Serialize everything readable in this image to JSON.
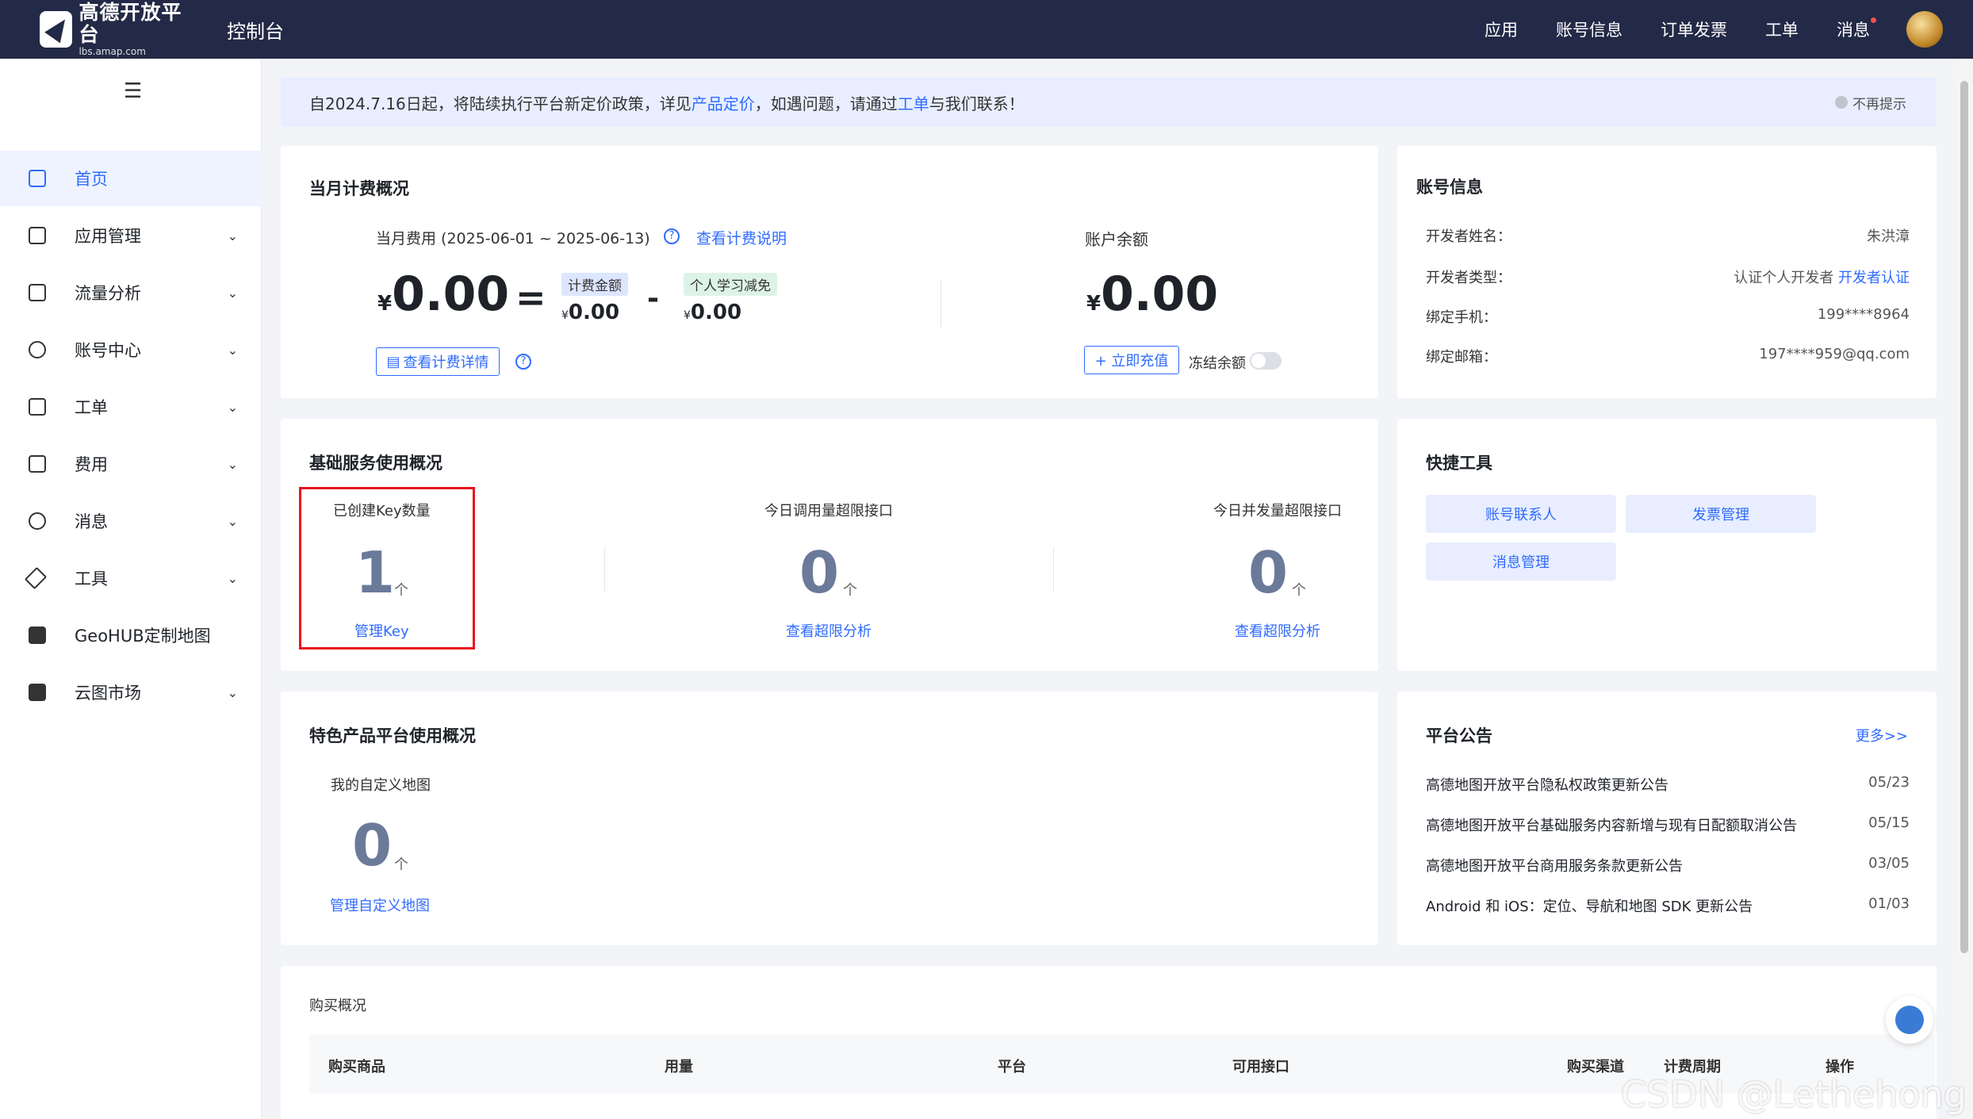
{
  "header": {
    "logo_title": "高德开放平台",
    "logo_sub": "lbs.amap.com",
    "console": "控制台",
    "nav": [
      "应用",
      "账号信息",
      "订单发票",
      "工单",
      "消息"
    ]
  },
  "sidebar": {
    "items": [
      {
        "label": "首页",
        "icon": "home-icon",
        "chevron": false
      },
      {
        "label": "应用管理",
        "icon": "grid-icon",
        "chevron": true
      },
      {
        "label": "流量分析",
        "icon": "chart-icon",
        "chevron": true
      },
      {
        "label": "账号中心",
        "icon": "user-icon",
        "chevron": true
      },
      {
        "label": "工单",
        "icon": "ticket-icon",
        "chevron": true
      },
      {
        "label": "费用",
        "icon": "yen-icon",
        "chevron": true
      },
      {
        "label": "消息",
        "icon": "message-icon",
        "chevron": true
      },
      {
        "label": "工具",
        "icon": "wrench-icon",
        "chevron": true
      },
      {
        "label": "GeoHUB定制地图",
        "icon": "layers-icon",
        "chevron": false
      },
      {
        "label": "云图市场",
        "icon": "store-icon",
        "chevron": true
      }
    ]
  },
  "notice": {
    "part1": "自2024.7.16日起，将陆续执行平台新定价政策，详见",
    "link1": "产品定价",
    "part2": "，如遇问题，请通过",
    "link2": "工单",
    "part3": "与我们联系！",
    "dismiss": "不再提示"
  },
  "billing": {
    "title": "当月计费概况",
    "period_label": "当月费用 (2025-06-01 ~ 2025-06-13)",
    "explain_link": "查看计费说明",
    "currency": "¥",
    "total": "0.00",
    "equals": "=",
    "minus": "-",
    "charge_tag": "计费金额",
    "charge_value": "0.00",
    "discount_tag": "个人学习减免",
    "discount_value": "0.00",
    "detail_button": "查看计费详情",
    "balance_label": "账户余额",
    "balance": "0.00",
    "recharge_button": "+ 立即充值",
    "freeze_label": "冻结余额"
  },
  "account": {
    "title": "账号信息",
    "rows": [
      {
        "label": "开发者姓名：",
        "value": "朱洪漳"
      },
      {
        "label": "开发者类型：",
        "value": "认证个人开发者",
        "link": "开发者认证"
      },
      {
        "label": "绑定手机：",
        "value": "199****8964"
      },
      {
        "label": "绑定邮箱：",
        "value": "197****959@qq.com"
      }
    ]
  },
  "basic": {
    "title": "基础服务使用概况",
    "stats": [
      {
        "label": "已创建Key数量",
        "value": "1",
        "unit": "个",
        "link": "管理Key"
      },
      {
        "label": "今日调用量超限接口",
        "value": "0",
        "unit": "个",
        "link": "查看超限分析"
      },
      {
        "label": "今日并发量超限接口",
        "value": "0",
        "unit": "个",
        "link": "查看超限分析"
      }
    ]
  },
  "quick": {
    "title": "快捷工具",
    "buttons": [
      "账号联系人",
      "发票管理",
      "消息管理"
    ]
  },
  "featured": {
    "title": "特色产品平台使用概况",
    "label": "我的自定义地图",
    "value": "0",
    "unit": "个",
    "link": "管理自定义地图"
  },
  "announcements": {
    "title": "平台公告",
    "more": "更多>>",
    "items": [
      {
        "text": "高德地图开放平台隐私权政策更新公告",
        "date": "05/23"
      },
      {
        "text": "高德地图开放平台基础服务内容新增与现有日配额取消公告",
        "date": "05/15"
      },
      {
        "text": "高德地图开放平台商用服务条款更新公告",
        "date": "03/05"
      },
      {
        "text": "Android 和 iOS：定位、导航和地图 SDK 更新公告",
        "date": "01/03"
      }
    ]
  },
  "purchase": {
    "title": "购买概况",
    "columns": [
      "购买商品",
      "用量",
      "平台",
      "可用接口",
      "购买渠道",
      "计费周期",
      "操作"
    ]
  },
  "watermark": "CSDN @Lethehong"
}
